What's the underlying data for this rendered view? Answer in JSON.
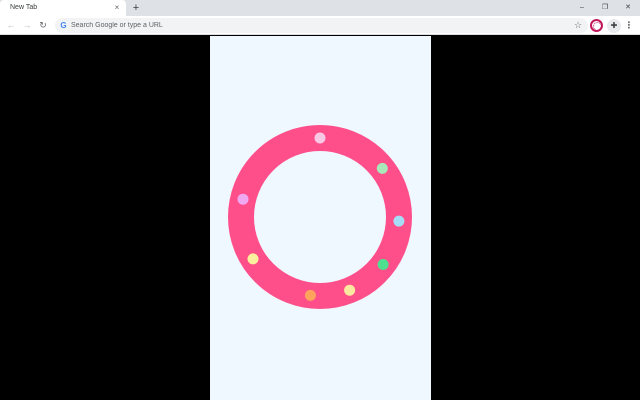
{
  "tab": {
    "title": "New Tab",
    "close_glyph": "×"
  },
  "tabstrip": {
    "new_tab_glyph": "+"
  },
  "window_controls": {
    "minimize": "–",
    "restore": "❐",
    "close": "✕"
  },
  "toolbar": {
    "back_glyph": "←",
    "forward_glyph": "→",
    "reload_glyph": "↻",
    "star_glyph": "☆",
    "menu_glyph": "⋮",
    "puzzle_glyph": "✚"
  },
  "omnibox": {
    "placeholder": "Search Google or type a URL",
    "value": "",
    "google_glyph": "G"
  },
  "game": {
    "ring_color": "#ff4f8b",
    "background_color": "#f0f8ff",
    "dots": [
      {
        "angle_deg": 270,
        "color": "#f8c8e4"
      },
      {
        "angle_deg": 322,
        "color": "#a9e8b8"
      },
      {
        "angle_deg": 193,
        "color": "#f0a8f0"
      },
      {
        "angle_deg": 3,
        "color": "#a6dcf5"
      },
      {
        "angle_deg": 148,
        "color": "#fbee9c"
      },
      {
        "angle_deg": 37,
        "color": "#4fe08f"
      },
      {
        "angle_deg": 68,
        "color": "#fde8a0"
      },
      {
        "angle_deg": 97,
        "color": "#ffa35c"
      }
    ]
  }
}
